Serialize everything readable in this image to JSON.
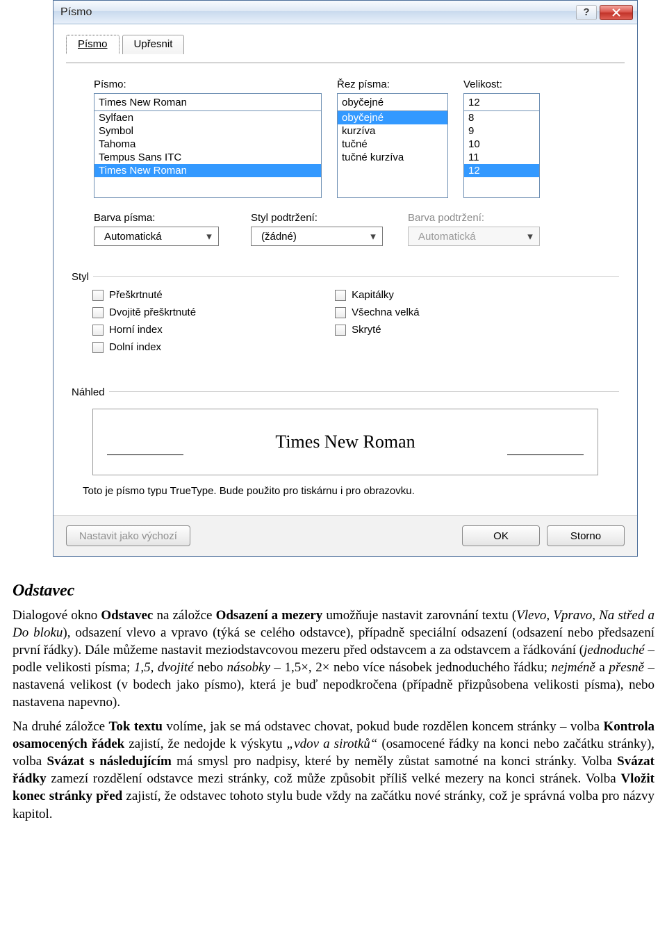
{
  "dialog": {
    "title": "Písmo",
    "tabs": {
      "font": "Písmo",
      "advanced": "Upřesnit"
    },
    "labels": {
      "font": "Písmo:",
      "style": "Řez písma:",
      "size": "Velikost:",
      "color": "Barva písma:",
      "underline_style": "Styl podtržení:",
      "underline_color": "Barva podtržení:"
    },
    "values": {
      "font": "Times New Roman",
      "style": "obyčejné",
      "size": "12",
      "color": "Automatická",
      "underline_style": "(žádné)",
      "underline_color": "Automatická"
    },
    "font_list": [
      "Sylfaen",
      "Symbol",
      "Tahoma",
      "Tempus Sans ITC",
      "Times New Roman"
    ],
    "style_list": [
      "obyčejné",
      "kurzíva",
      "tučné",
      "tučné kurzíva"
    ],
    "size_list": [
      "8",
      "9",
      "10",
      "11",
      "12"
    ],
    "group_style_title": "Styl",
    "group_preview_title": "Náhled",
    "effects_left": [
      "Přeškrtnuté",
      "Dvojitě přeškrtnuté",
      "Horní index",
      "Dolní index"
    ],
    "effects_right": [
      "Kapitálky",
      "Všechna velká",
      "Skryté"
    ],
    "preview_text": "Times New Roman",
    "hint": "Toto je písmo typu TrueType. Bude použito pro tiskárnu i pro obrazovku.",
    "buttons": {
      "default": "Nastavit jako výchozí",
      "ok": "OK",
      "cancel": "Storno"
    }
  },
  "doc": {
    "heading": "Odstavec",
    "p1a": "Dialogové okno ",
    "p1b": "Odstavec",
    "p1c": " na záložce ",
    "p1d": "Odsazení a mezery",
    "p1e": " umožňuje nastavit zarovnání textu (",
    "p1f": "Vlevo, Vpravo, Na střed a Do bloku",
    "p1g": "), odsazení vlevo a vpravo (týká se celého odstavce), případně speciální odsazení (odsazení nebo předsazení první řádky). Dále můžeme nastavit meziodstavcovou mezeru před odstavcem a za odstavcem a řádkování (",
    "p1h": "jednoduché",
    "p1i": " – podle velikosti písma; ",
    "p1j": "1,5, dvojité",
    "p1k": " nebo ",
    "p1l": "násobky",
    "p1m": " – 1,5×, 2× nebo více násobek jednoduchého řádku; ",
    "p1n": "nejméně",
    "p1o": " a ",
    "p1p": "přesně",
    "p1q": " – nastavená velikost (v bodech jako písmo), která je buď nepodkročena (případně přizpůsobena velikosti písma), nebo nastavena napevno).",
    "p2a": "Na druhé záložce ",
    "p2b": "Tok textu",
    "p2c": " volíme, jak se má odstavec chovat, pokud bude rozdělen koncem stránky – volba ",
    "p2d": "Kontrola osamocených řádek",
    "p2e": " zajistí, že nedojde k výskytu ",
    "p2f": "„vdov a sirotků“",
    "p2g": " (osamocené řádky na konci nebo začátku stránky), volba ",
    "p2h": "Svázat s následujícím",
    "p2i": " má smysl pro nadpisy, které by neměly zůstat samotné na konci stránky. Volba ",
    "p2j": "Svázat řádky",
    "p2k": " zamezí rozdělení odstavce mezi stránky, což může způsobit příliš velké mezery na konci stránek. Volba ",
    "p2l": "Vložit konec stránky před",
    "p2m": " zajistí, že odstavec tohoto stylu bude vždy na začátku nové stránky, což je správná volba pro názvy kapitol."
  }
}
